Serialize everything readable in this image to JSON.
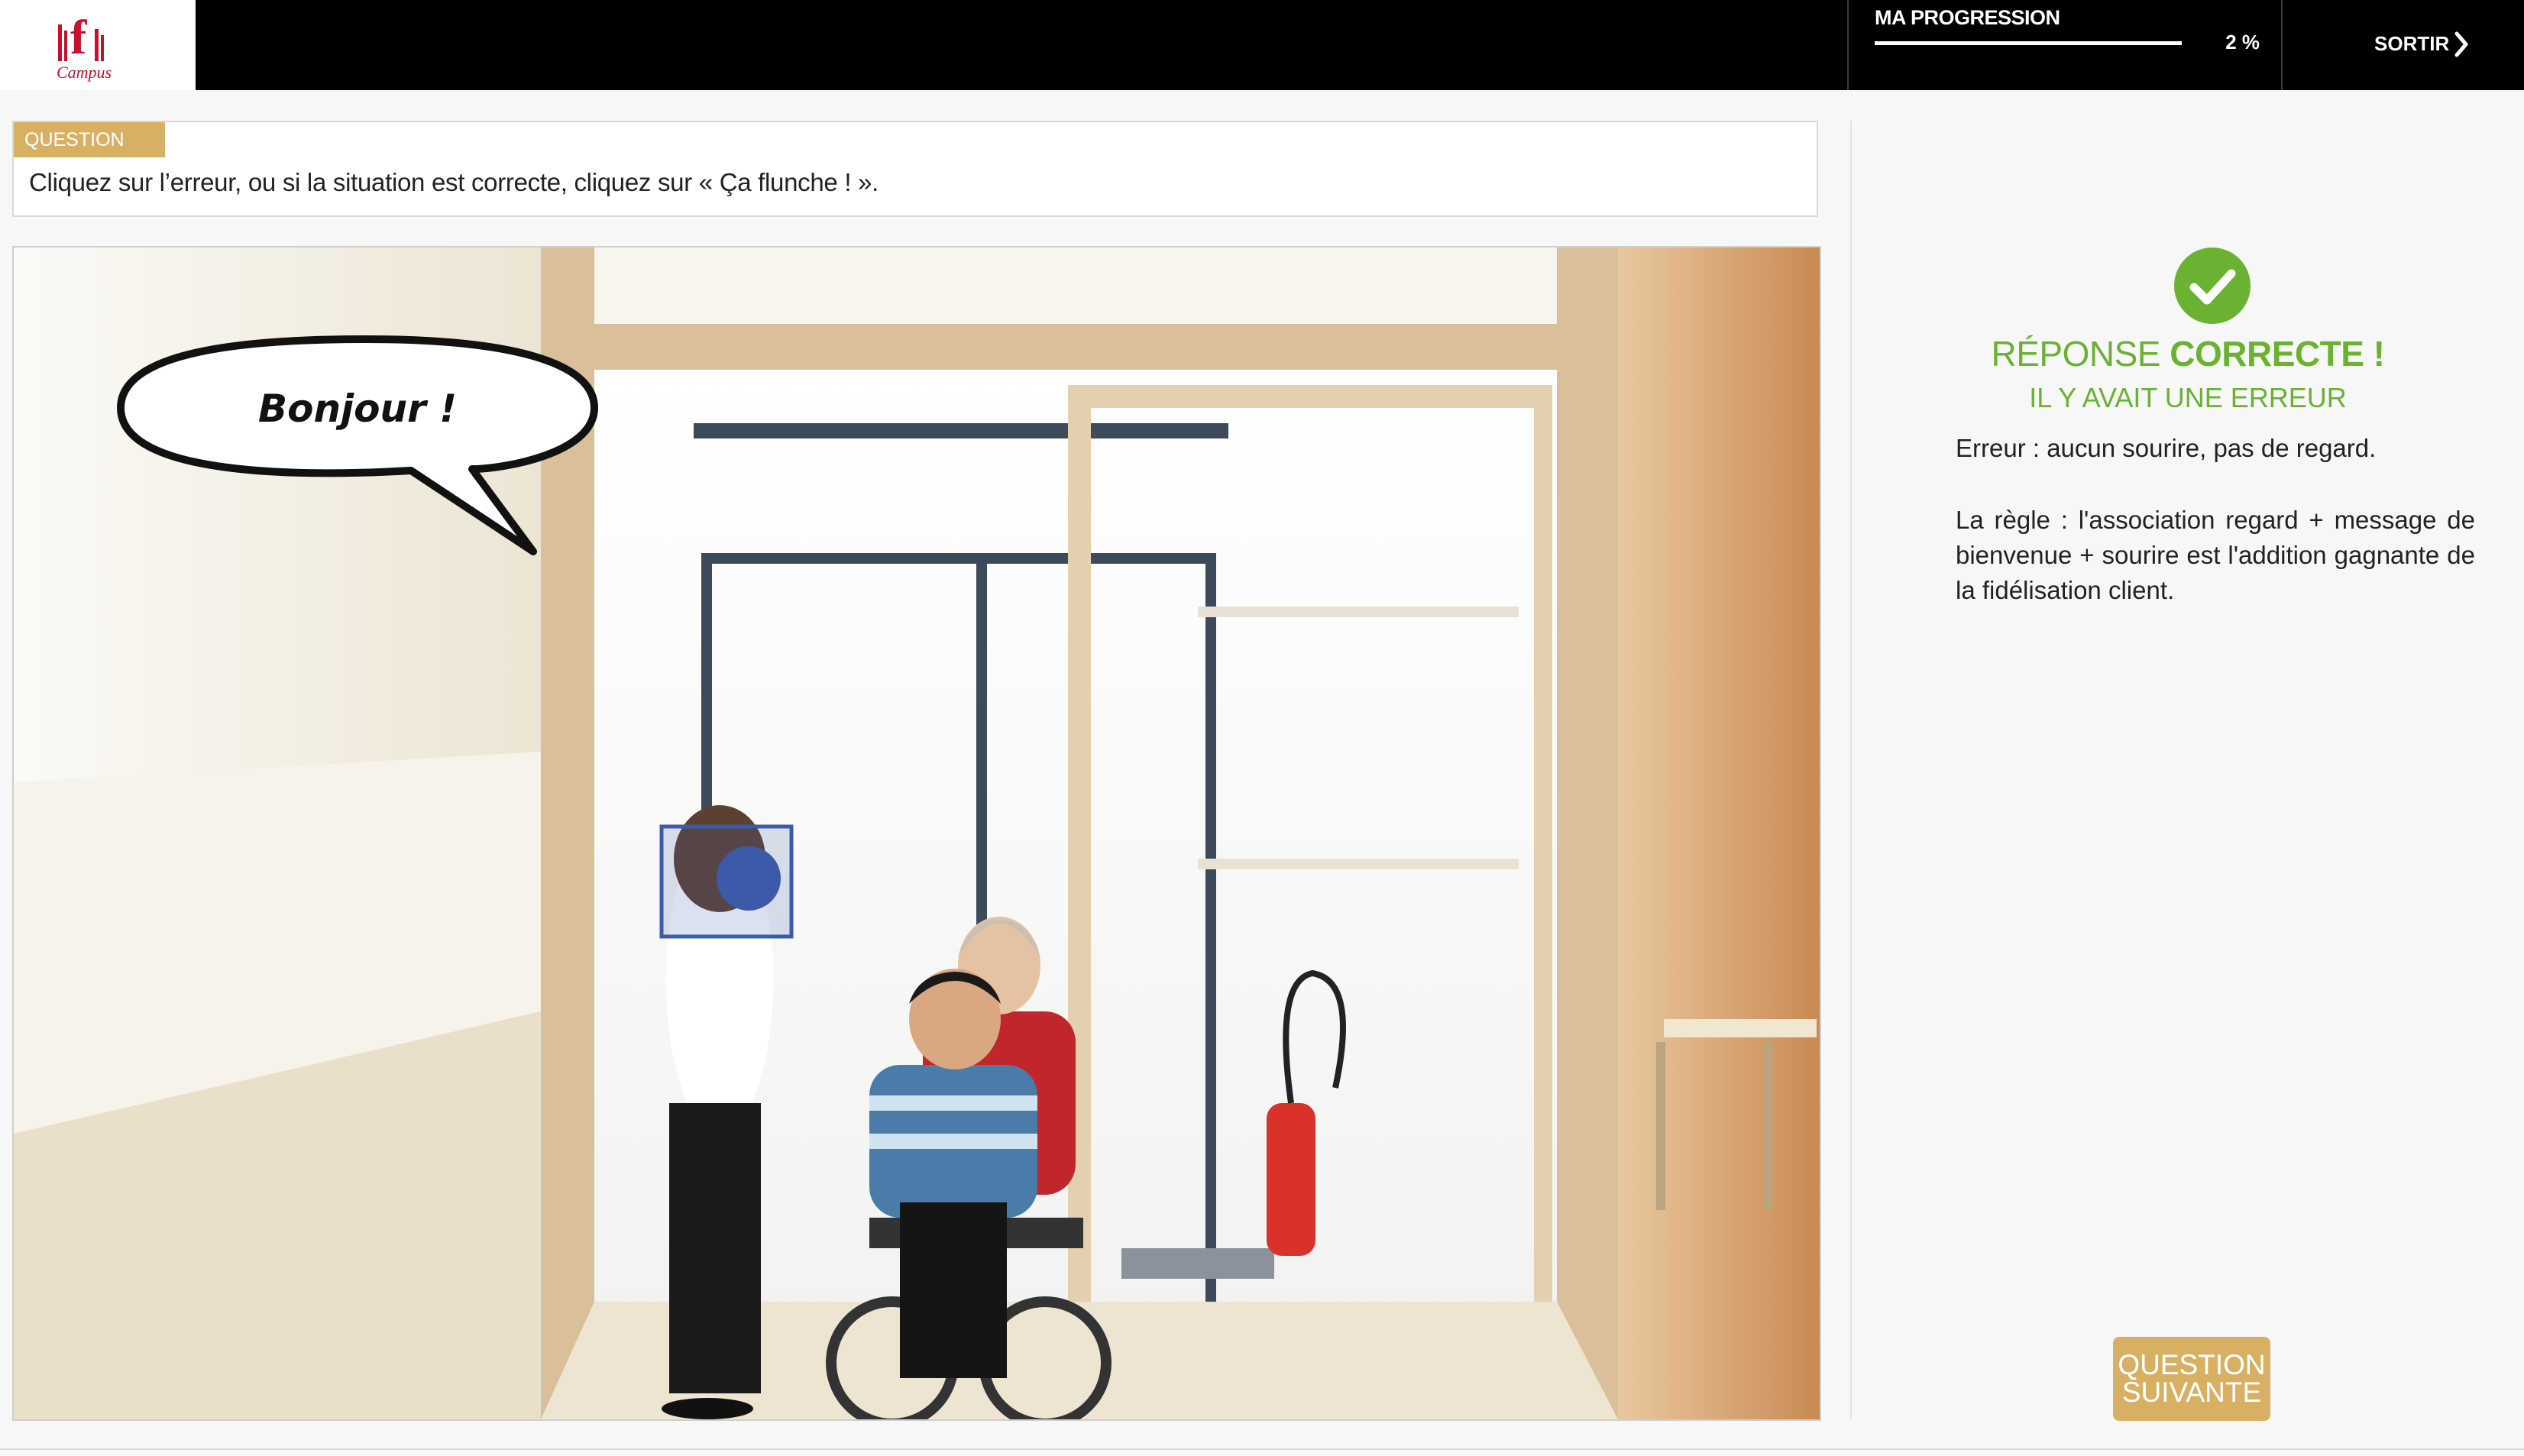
{
  "header": {
    "logo_text": "Campus",
    "progress_label": "MA PROGRESSION",
    "progress_percent_text": "2 %",
    "progress_fraction": 0.02,
    "exit_label": "SORTIR"
  },
  "question": {
    "tag": "QUESTION",
    "text": "Cliquez sur l’erreur, ou si la situation est correcte, cliquez sur « Ça flunche ! »."
  },
  "scene": {
    "speech_bubble": "Bonjour !"
  },
  "feedback": {
    "title_prefix": "RÉPONSE",
    "title_strong": "CORRECTE !",
    "subtitle": "IL Y AVAIT UNE ERREUR",
    "error_text": "Erreur : aucun sourire, pas de regard.",
    "rule_text": "La règle : l'association regard + message de bienvenue + sourire est l'addition gagnante de la fidélisation client.",
    "next_button_line1": "QUESTION",
    "next_button_line2": "SUIVANTE"
  },
  "colors": {
    "accent_gold": "#d7b064",
    "success_green": "#6bb232",
    "marker_blue": "#3b5ba8"
  }
}
